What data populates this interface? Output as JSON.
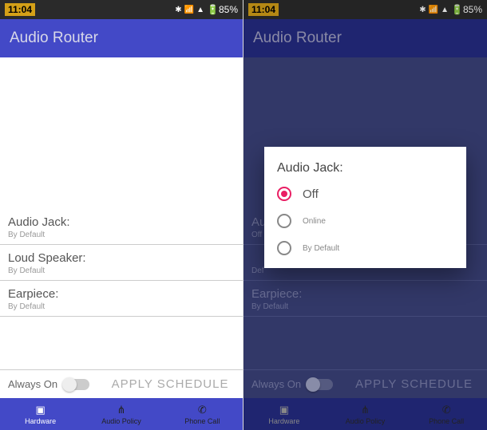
{
  "status": {
    "time": "11:04",
    "battery": "85%"
  },
  "app": {
    "title": "Audio Router"
  },
  "settings": [
    {
      "title": "Audio Jack:",
      "sub": "By Default"
    },
    {
      "title": "Loud Speaker:",
      "sub": "By Default"
    },
    {
      "title": "Earpiece:",
      "sub": "By Default"
    }
  ],
  "bottom": {
    "always_on": "Always On",
    "apply": "APPLY SCHEDULE"
  },
  "nav": {
    "hardware": "Hardware",
    "audio_policy": "Audio Policy",
    "phone_call": "Phone Call"
  },
  "dialog": {
    "title": "Audio Jack:",
    "opt_off": "Off",
    "opt_online": "Online",
    "opt_default": "By Default",
    "selected": "Off"
  },
  "screen2_peek": {
    "au": "Au",
    "off": "Off",
    "def": "Def"
  }
}
